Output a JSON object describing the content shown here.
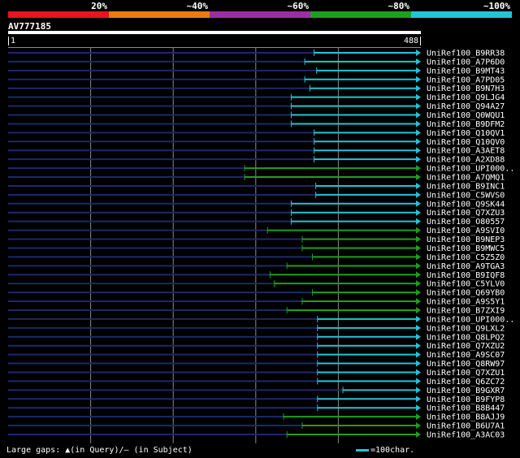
{
  "legend": {
    "segments": [
      {
        "label": "20%",
        "color": "#e8141e"
      },
      {
        "label": "~40%",
        "color": "#e87b14"
      },
      {
        "label": "~60%",
        "color": "#9c2ea3"
      },
      {
        "label": "~80%",
        "color": "#1ea01e"
      },
      {
        "label": "~100%",
        "color": "#22c4d6"
      }
    ]
  },
  "query": {
    "id": "AV777185",
    "start": "1",
    "end": "488"
  },
  "colors": {
    "background": "#000000",
    "background_line": "#1a2a6c",
    "grid": "#8a8a8a"
  },
  "hits": [
    {
      "name": "UniRef100_B9RR38",
      "start": 362,
      "end": 488,
      "color": "#22c4d6"
    },
    {
      "name": "UniRef100_A7P6D0",
      "start": 351,
      "end": 488,
      "color": "#22c4d6"
    },
    {
      "name": "UniRef100_B9MT43",
      "start": 365,
      "end": 488,
      "color": "#22c4d6"
    },
    {
      "name": "UniRef100_A7PD05",
      "start": 351,
      "end": 488,
      "color": "#22c4d6"
    },
    {
      "name": "UniRef100_B9N7H3",
      "start": 357,
      "end": 488,
      "color": "#22c4d6"
    },
    {
      "name": "UniRef100_Q9LJG4",
      "start": 335,
      "end": 488,
      "color": "#22c4d6"
    },
    {
      "name": "UniRef100_Q94A27",
      "start": 335,
      "end": 488,
      "color": "#22c4d6"
    },
    {
      "name": "UniRef100_Q0WQU1",
      "start": 335,
      "end": 488,
      "color": "#22c4d6"
    },
    {
      "name": "UniRef100_B9DFM2",
      "start": 335,
      "end": 488,
      "color": "#22c4d6"
    },
    {
      "name": "UniRef100_Q10QV1",
      "start": 362,
      "end": 488,
      "color": "#22c4d6"
    },
    {
      "name": "UniRef100_Q10QV0",
      "start": 362,
      "end": 488,
      "color": "#22c4d6"
    },
    {
      "name": "UniRef100_A3AET8",
      "start": 362,
      "end": 488,
      "color": "#22c4d6"
    },
    {
      "name": "UniRef100_A2XD88",
      "start": 362,
      "end": 488,
      "color": "#22c4d6"
    },
    {
      "name": "UniRef100_UPI000..",
      "start": 280,
      "end": 488,
      "color": "#1ea01e"
    },
    {
      "name": "UniRef100_A7QMQ1",
      "start": 280,
      "end": 488,
      "color": "#1ea01e"
    },
    {
      "name": "UniRef100_B9INC1",
      "start": 364,
      "end": 488,
      "color": "#22c4d6"
    },
    {
      "name": "UniRef100_C5WVS0",
      "start": 364,
      "end": 488,
      "color": "#22c4d6"
    },
    {
      "name": "UniRef100_Q9SK44",
      "start": 335,
      "end": 488,
      "color": "#22c4d6"
    },
    {
      "name": "UniRef100_Q7XZU3",
      "start": 335,
      "end": 488,
      "color": "#22c4d6"
    },
    {
      "name": "UniRef100_O80557",
      "start": 335,
      "end": 488,
      "color": "#22c4d6"
    },
    {
      "name": "UniRef100_A9SVI0",
      "start": 307,
      "end": 488,
      "color": "#1ea01e"
    },
    {
      "name": "UniRef100_B9NEP3",
      "start": 348,
      "end": 488,
      "color": "#1ea01e"
    },
    {
      "name": "UniRef100_B9MWC5",
      "start": 348,
      "end": 488,
      "color": "#1ea01e"
    },
    {
      "name": "UniRef100_C5Z5Z0",
      "start": 360,
      "end": 488,
      "color": "#1ea01e"
    },
    {
      "name": "UniRef100_A9TGA3",
      "start": 330,
      "end": 488,
      "color": "#1ea01e"
    },
    {
      "name": "UniRef100_B9IQF8",
      "start": 310,
      "end": 488,
      "color": "#1ea01e"
    },
    {
      "name": "UniRef100_C5YLV0",
      "start": 315,
      "end": 488,
      "color": "#1ea01e"
    },
    {
      "name": "UniRef100_Q69YB0",
      "start": 360,
      "end": 488,
      "color": "#1ea01e"
    },
    {
      "name": "UniRef100_A9S5Y1",
      "start": 348,
      "end": 488,
      "color": "#1ea01e"
    },
    {
      "name": "UniRef100_B7ZXI9",
      "start": 330,
      "end": 488,
      "color": "#1ea01e"
    },
    {
      "name": "UniRef100_UPI000..",
      "start": 366,
      "end": 488,
      "color": "#22c4d6"
    },
    {
      "name": "UniRef100_Q9LXL2",
      "start": 366,
      "end": 488,
      "color": "#22c4d6"
    },
    {
      "name": "UniRef100_Q8LPQ2",
      "start": 366,
      "end": 488,
      "color": "#22c4d6"
    },
    {
      "name": "UniRef100_Q7XZU2",
      "start": 366,
      "end": 488,
      "color": "#22c4d6"
    },
    {
      "name": "UniRef100_A9SC07",
      "start": 366,
      "end": 488,
      "color": "#22c4d6"
    },
    {
      "name": "UniRef100_Q8RW97",
      "start": 366,
      "end": 488,
      "color": "#22c4d6"
    },
    {
      "name": "UniRef100_Q7XZU1",
      "start": 366,
      "end": 488,
      "color": "#22c4d6"
    },
    {
      "name": "UniRef100_Q6ZC72",
      "start": 366,
      "end": 488,
      "color": "#22c4d6"
    },
    {
      "name": "UniRef100_B9GXR7",
      "start": 396,
      "end": 488,
      "color": "#22c4d6"
    },
    {
      "name": "UniRef100_B9FYP8",
      "start": 366,
      "end": 488,
      "color": "#22c4d6"
    },
    {
      "name": "UniRef100_B8B447",
      "start": 366,
      "end": 488,
      "color": "#22c4d6"
    },
    {
      "name": "UniRef100_B8AJJ9",
      "start": 326,
      "end": 488,
      "color": "#1ea01e"
    },
    {
      "name": "UniRef100_B6U7A1",
      "start": 348,
      "end": 488,
      "color": "#1ea01e"
    },
    {
      "name": "UniRef100_A3AC03",
      "start": 330,
      "end": 488,
      "color": "#1ea01e"
    }
  ],
  "footer": {
    "gaps_text": "Large gaps: ▲(in Query)/– (in Subject)",
    "scale_text": "=100char."
  }
}
